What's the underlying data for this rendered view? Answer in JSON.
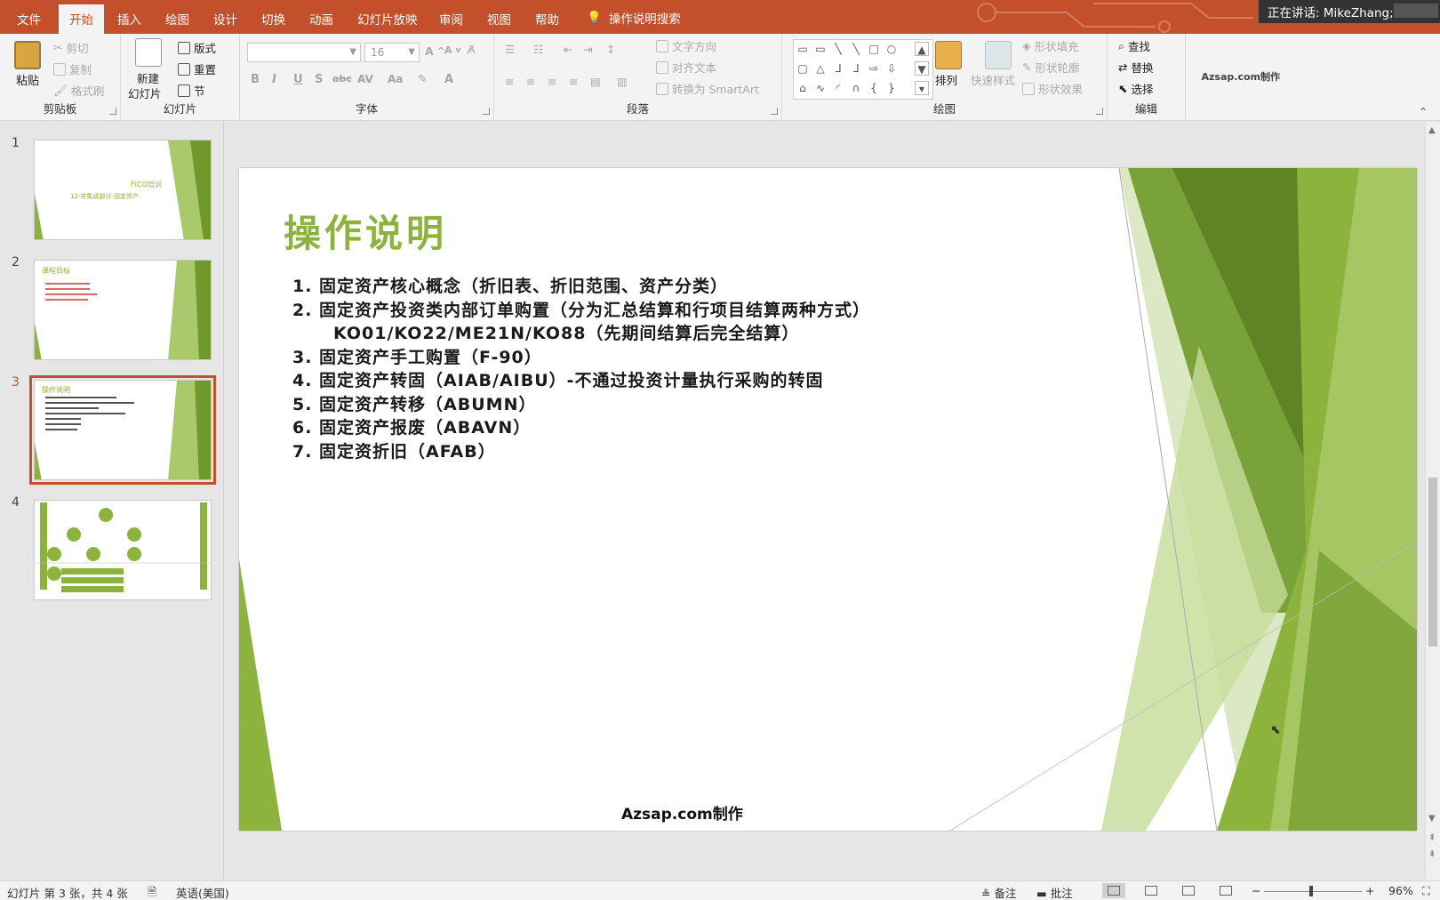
{
  "menubar": {
    "tabs": [
      "文件",
      "开始",
      "插入",
      "绘图",
      "设计",
      "切换",
      "动画",
      "幻灯片放映",
      "审阅",
      "视图",
      "帮助"
    ],
    "active_tab": "开始",
    "tell_me": "操作说明搜索",
    "presenter": "正在讲话: MikeZhang;"
  },
  "ribbon": {
    "clipboard": {
      "paste": "粘贴",
      "cut": "剪切",
      "copy": "复制",
      "format_painter": "格式刷",
      "label": "剪贴板"
    },
    "slides": {
      "new_slide_line1": "新建",
      "new_slide_line2": "幻灯片",
      "layout": "版式",
      "reset": "重置",
      "section": "节",
      "label": "幻灯片"
    },
    "font": {
      "font_name": "",
      "font_size": "16",
      "label": "字体"
    },
    "paragraph": {
      "text_direction": "文字方向",
      "align_text": "对齐文本",
      "convert_smartart": "转换为 SmartArt",
      "label": "段落"
    },
    "drawing": {
      "arrange": "排列",
      "quick_styles": "快速样式",
      "shape_fill": "形状填充",
      "shape_outline": "形状轮廓",
      "shape_effects": "形状效果",
      "label": "绘图"
    },
    "editing": {
      "find": "查找",
      "replace": "替换",
      "select": "选择",
      "label": "编辑"
    },
    "watermark": "Azsap.com制作"
  },
  "thumbnails": [
    {
      "num": "1",
      "title_line1": "FICO培训",
      "title_line2": "12-非集成部分-固定资产"
    },
    {
      "num": "2",
      "title": "课程目标"
    },
    {
      "num": "3",
      "title": "操作说明",
      "selected": true
    },
    {
      "num": "4",
      "title": ""
    }
  ],
  "slide": {
    "title": "操作说明",
    "items": [
      "1.  固定资产核心概念（折旧表、折旧范围、资产分类）",
      "2.  固定资产投资类内部订单购置（分为汇总结算和行项目结算两种方式）",
      "KO01/KO22/ME21N/KO88（先期间结算后完全结算）",
      "3. 固定资产手工购置（F-90）",
      "4. 固定资产转固（AIAB/AIBU）-不通过投资计量执行采购的转固",
      "5. 固定资产转移（ABUMN）",
      "6. 固定资产报废（ABAVN）",
      "7. 固定资折旧（AFAB）"
    ],
    "footer": "Azsap.com制作"
  },
  "statusbar": {
    "slide_info": "幻灯片 第 3 张，共 4 张",
    "language": "英语(美国)",
    "notes": "备注",
    "comments": "批注",
    "zoom_minus": "−",
    "zoom_plus": "+",
    "zoom": "96%"
  },
  "colors": {
    "accent": "#c4502b",
    "green": "#8cb43d",
    "ribbon_bg": "#f3f3f3"
  }
}
